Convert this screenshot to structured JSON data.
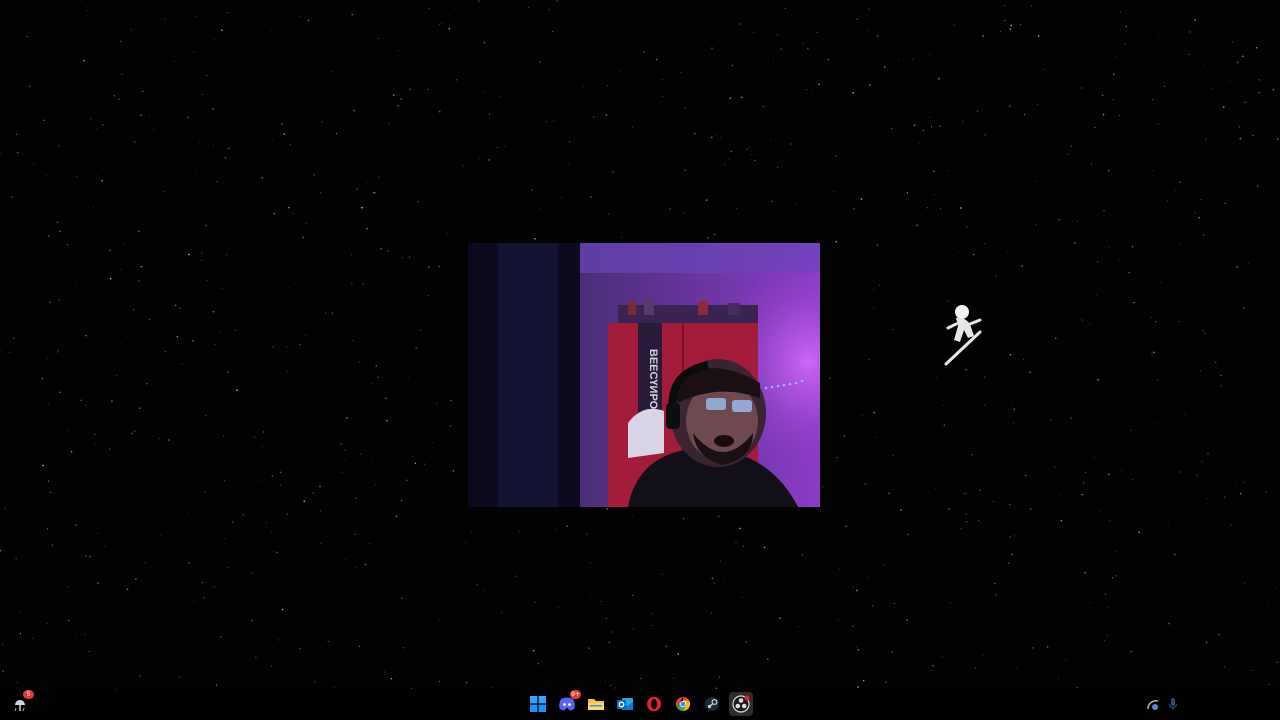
{
  "desktop": {
    "wallpaper": "starfield",
    "background_color": "#020203"
  },
  "webcam": {
    "poster_text": "ВЕЕСҮИРОИ"
  },
  "taskbar": {
    "weather_badge_count": "5",
    "apps": [
      {
        "name": "start",
        "icon": "windows-logo-icon",
        "color": "#1e90ff"
      },
      {
        "name": "discord",
        "icon": "discord-icon",
        "color": "#5865f2",
        "badge": "9+"
      },
      {
        "name": "file-explorer",
        "icon": "folder-icon",
        "color": "#f5c542"
      },
      {
        "name": "outlook",
        "icon": "outlook-icon",
        "color": "#0f6cbd"
      },
      {
        "name": "opera",
        "icon": "opera-icon",
        "color": "#e3202b"
      },
      {
        "name": "chrome",
        "icon": "chrome-icon",
        "color": "#34a853"
      },
      {
        "name": "steam",
        "icon": "steam-icon",
        "color": "#9ab6cf"
      },
      {
        "name": "obs-studio",
        "icon": "obs-icon",
        "color": "#ffffff",
        "active": true
      }
    ],
    "tray": [
      {
        "icon": "network-icon"
      },
      {
        "icon": "microphone-icon"
      }
    ]
  }
}
